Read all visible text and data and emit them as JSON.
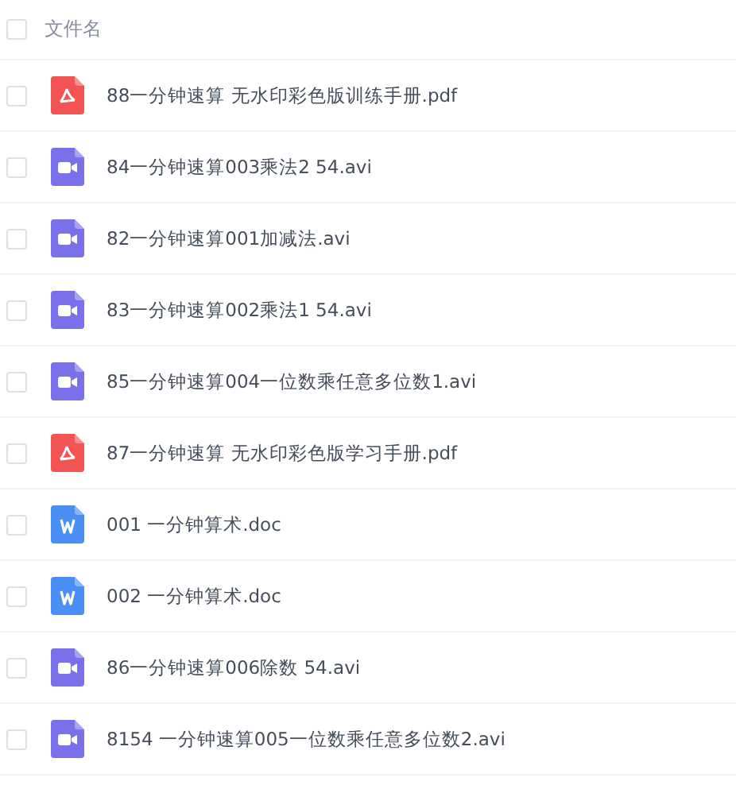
{
  "header": {
    "label": "文件名",
    "checked": false
  },
  "files": [
    {
      "name": "88一分钟速算 无水印彩色版训练手册.pdf",
      "kind": "pdf",
      "checked": false
    },
    {
      "name": "84一分钟速算003乘法2 54.avi",
      "kind": "video",
      "checked": false
    },
    {
      "name": "82一分钟速算001加减法.avi",
      "kind": "video",
      "checked": false
    },
    {
      "name": "83一分钟速算002乘法1 54.avi",
      "kind": "video",
      "checked": false
    },
    {
      "name": "85一分钟速算004一位数乘任意多位数1.avi",
      "kind": "video",
      "checked": false
    },
    {
      "name": "87一分钟速算 无水印彩色版学习手册.pdf",
      "kind": "pdf",
      "checked": false
    },
    {
      "name": "001 一分钟算术.doc",
      "kind": "doc",
      "checked": false
    },
    {
      "name": "002 一分钟算术.doc",
      "kind": "doc",
      "checked": false
    },
    {
      "name": "86一分钟速算006除数 54.avi",
      "kind": "video",
      "checked": false
    },
    {
      "name": "8154 一分钟速算005一位数乘任意多位数2.avi",
      "kind": "video",
      "checked": false
    }
  ]
}
